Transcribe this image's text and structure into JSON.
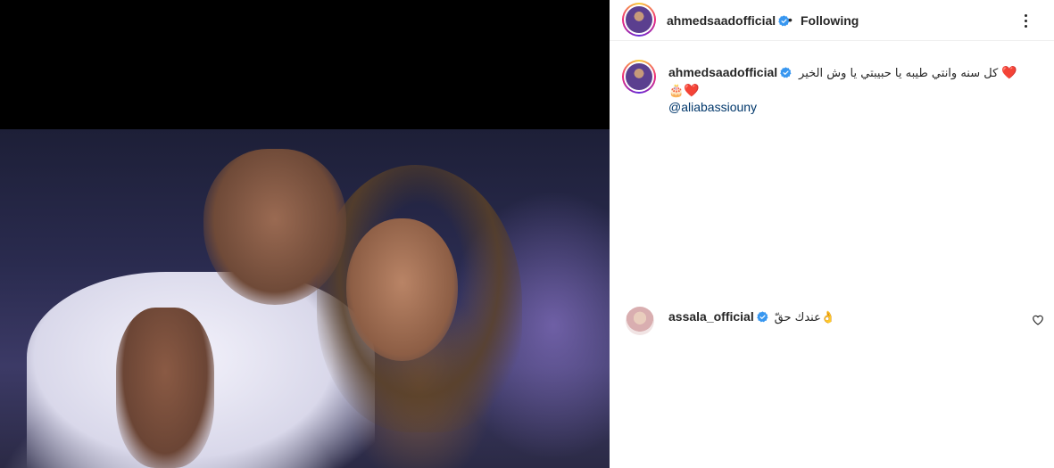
{
  "post": {
    "author": "ahmedsaadofficial",
    "header": {
      "dot": "•",
      "follow_status": "Following"
    },
    "caption": {
      "text": "كل سنه وانتي طيبه يا حبيبتي يا وش الخير",
      "emoji_line1": "❤️",
      "emoji_line2": "🎂❤️",
      "mention": "@aliabassiouny"
    }
  },
  "comments": [
    {
      "username": "assala_official",
      "text": "عندك حقّ👌"
    }
  ],
  "icons": {
    "verified": "verified-badge-icon",
    "more": "more-options-icon",
    "like": "heart-outline-icon"
  },
  "colors": {
    "verified_blue": "#3897f0",
    "mention": "#00376b",
    "heart": "#e0245e"
  }
}
